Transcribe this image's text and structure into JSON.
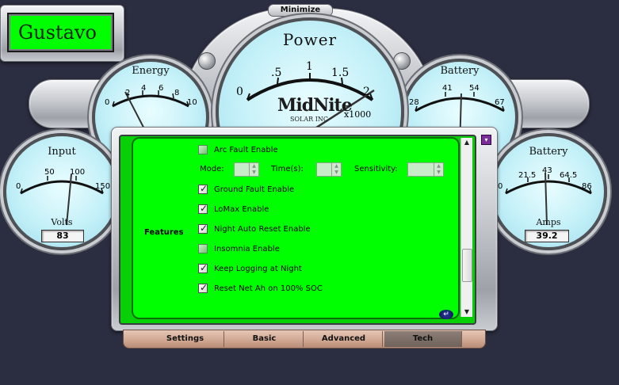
{
  "app": {
    "controller_name": "Gustavo",
    "minimize_label": "Minimize"
  },
  "gauges": {
    "power": {
      "title": "Power",
      "ticks": [
        "0",
        ".5",
        "1",
        "1.5",
        "2"
      ],
      "multiplier": "x1000",
      "brand": "MidNite",
      "brand_sub": "SOLAR INC"
    },
    "energy": {
      "title": "Energy",
      "ticks": [
        "0",
        "2",
        "4",
        "6",
        "8",
        "10"
      ]
    },
    "battery_volts": {
      "title": "Battery",
      "ticks": [
        "28",
        "41",
        "54",
        "67"
      ]
    },
    "input": {
      "title": "Input",
      "ticks": [
        "0",
        "50",
        "100",
        "150"
      ],
      "unit": "Volts",
      "readout": "83"
    },
    "battery_amps": {
      "title": "Battery",
      "ticks": [
        "0",
        "21.5",
        "43",
        "64.5",
        "86"
      ],
      "unit": "Amps",
      "readout": "39.2"
    }
  },
  "features": {
    "section_label": "Features",
    "arc_fault": {
      "label": "Arc Fault Enable",
      "checked": false
    },
    "mode_label": "Mode:",
    "time_label": "Time(s):",
    "sensitivity_label": "Sensitivity:",
    "mode_value": "",
    "time_value": "",
    "sensitivity_value": "",
    "options": [
      {
        "label": "Ground Fault Enable",
        "checked": true
      },
      {
        "label": "LoMax Enable",
        "checked": true
      },
      {
        "label": "Night Auto Reset Enable",
        "checked": true
      },
      {
        "label": "Insomnia Enable",
        "checked": false
      },
      {
        "label": "Keep Logging at Night",
        "checked": true
      },
      {
        "label": "Reset Net Ah on 100% SOC",
        "checked": true
      }
    ]
  },
  "tabs": [
    {
      "label": "Settings",
      "active": false
    },
    {
      "label": "Basic",
      "active": false
    },
    {
      "label": "Advanced",
      "active": false
    },
    {
      "label": "Tech",
      "active": true
    }
  ],
  "colors": {
    "panel_green": "#00ff00",
    "gauge_face": "#c3f0f8",
    "background": "#2b2d40",
    "tab_active": "#7a6d66"
  }
}
